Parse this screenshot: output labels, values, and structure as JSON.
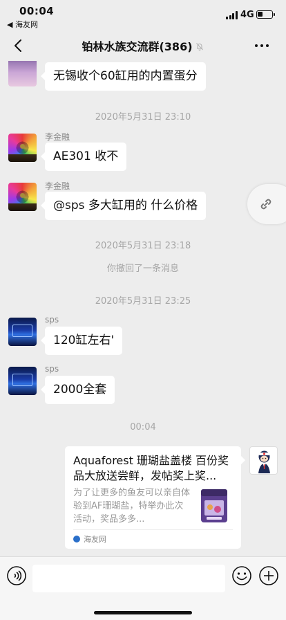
{
  "status_bar": {
    "time": "00:04",
    "back_app": "◀ 海友网",
    "network": "4G",
    "battery_level": 0.35
  },
  "nav": {
    "title": "铂林水族交流群",
    "member_count": "(386)"
  },
  "messages": [
    {
      "sender": "",
      "text": "无锡收个60缸用的内置蛋分"
    },
    {
      "timestamp": "2020年5月31日 23:10"
    },
    {
      "sender": "李金融",
      "text": "AE301 收不"
    },
    {
      "sender": "李金融",
      "text": "@sps 多大缸用的 什么价格"
    },
    {
      "timestamp": "2020年5月31日 23:18"
    },
    {
      "system": "你撤回了一条消息"
    },
    {
      "timestamp": "2020年5月31日 23:25"
    },
    {
      "sender": "sps",
      "text": "120缸左右'"
    },
    {
      "sender": "sps",
      "text": "2000全套"
    },
    {
      "timestamp": "00:04"
    }
  ],
  "link_card": {
    "title": "Aquaforest 珊瑚盐盖楼 百份奖品大放送尝鲜，发帖奖上奖...",
    "description": "为了让更多的鱼友可以亲自体验到AF珊瑚盐，特举办此次活动，奖品多多...",
    "source": "海友网"
  },
  "input_bar": {
    "placeholder": ""
  },
  "colors": {
    "background": "#ededed",
    "bubble": "#ffffff",
    "timestamp_text": "#a6a6a6"
  }
}
